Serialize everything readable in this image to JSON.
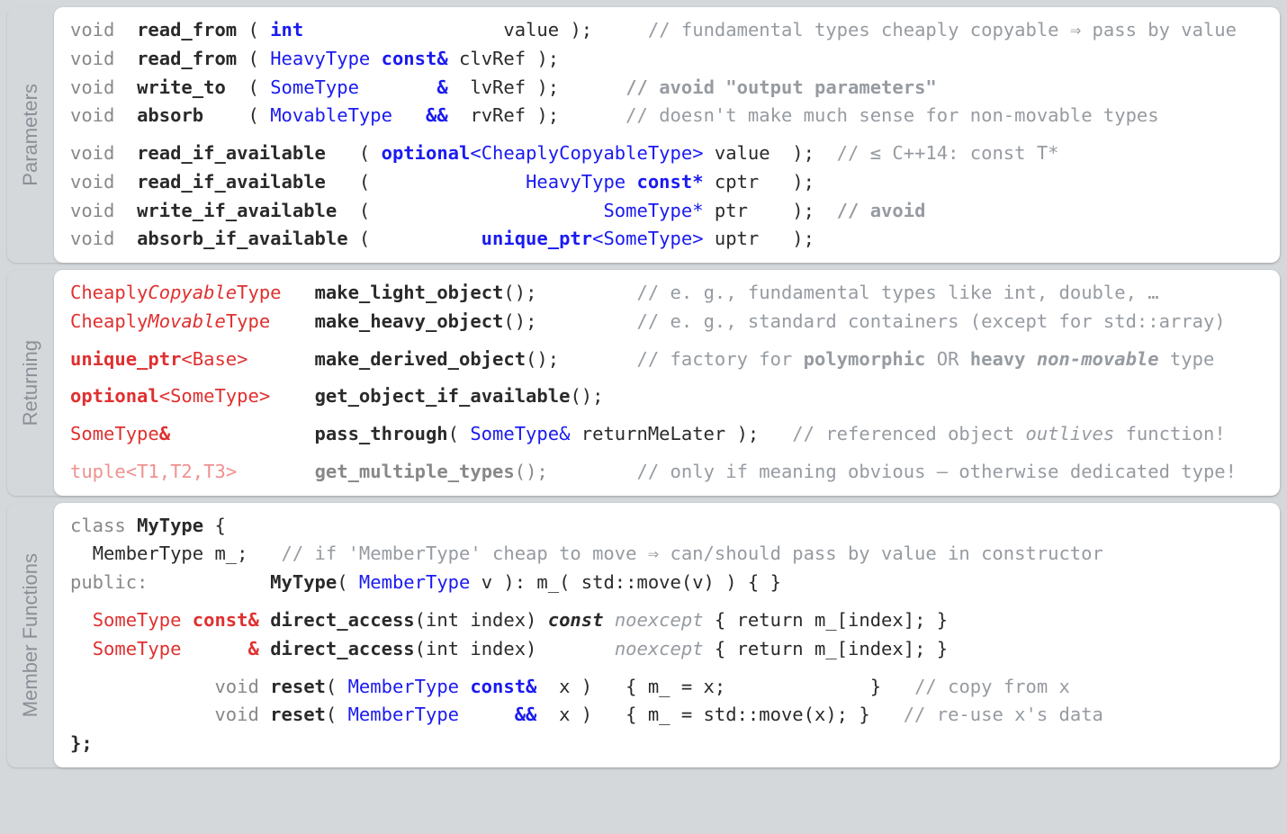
{
  "sections": {
    "parameters": {
      "label": "Parameters",
      "lines": {
        "l1": {
          "void": "void",
          "fn": "read_from",
          "paren": "(",
          "type": "int",
          "arg": "value",
          "end": ");",
          "cm": "// fundamental types cheaply copyable ⇒ pass by value"
        },
        "l2": {
          "void": "void",
          "fn": "read_from",
          "paren": "(",
          "type": "HeavyType",
          "mod": "const&",
          "arg": "clvRef",
          "end": ");"
        },
        "l3": {
          "void": "void",
          "fn": "write_to",
          "paren": "(",
          "type": "SomeType",
          "mod": "&",
          "arg": "lvRef",
          "end": ");",
          "cm": "// avoid \"output parameters\""
        },
        "l4": {
          "void": "void",
          "fn": "absorb",
          "paren": "(",
          "type": "MovableType",
          "mod": "&&",
          "arg": "rvRef",
          "end": ");",
          "cm": "// doesn't make much sense for non-movable types"
        },
        "l5": {
          "void": "void",
          "fn": "read_if_available",
          "paren": "(",
          "type1": "optional",
          "lt": "<",
          "type2": "CheaplyCopyableType",
          "gt": ">",
          "arg": "value",
          "end": ");",
          "cm": "// ≤ C++14: const T*"
        },
        "l6": {
          "void": "void",
          "fn": "read_if_available",
          "paren": "(",
          "type": "HeavyType",
          "mod": "const*",
          "arg": "cptr",
          "end": ");"
        },
        "l7": {
          "void": "void",
          "fn": "write_if_available",
          "paren": "(",
          "type": "SomeType*",
          "arg": "ptr",
          "end": ");",
          "cm": "// avoid"
        },
        "l8": {
          "void": "void",
          "fn": "absorb_if_available",
          "paren": "(",
          "type1": "unique_ptr",
          "lt": "<",
          "type2": "SomeType",
          "gt": ">",
          "arg": "uptr",
          "end": ");"
        }
      }
    },
    "returning": {
      "label": "Returning",
      "lines": {
        "l1": {
          "ret_pre": "Cheaply",
          "ret_em": "Copyable",
          "ret_post": "Type",
          "fn": "make_light_object",
          "paren": "();",
          "cm": "// e. g., fundamental types like int, double, …"
        },
        "l2": {
          "ret_pre": "Cheaply",
          "ret_em": "Movable",
          "ret_post": "Type",
          "fn": "make_heavy_object",
          "paren": "();",
          "cm": "// e. g., standard containers (except for std::array)"
        },
        "l3": {
          "ret": "unique_ptr",
          "lt": "<",
          "inner": "Base",
          "gt": ">",
          "fn": "make_derived_object",
          "paren": "();",
          "cm_pre": "// factory for ",
          "cm_b1": "polymorphic",
          "cm_mid": " OR ",
          "cm_b2": "heavy ",
          "cm_bi": "non-movable",
          "cm_post": " type"
        },
        "l4": {
          "ret": "optional",
          "lt": "<",
          "inner": "SomeType",
          "gt": ">",
          "fn": "get_object_if_available",
          "paren": "();"
        },
        "l5": {
          "ret": "SomeType",
          "amp": "&",
          "fn": "pass_through",
          "open": "(",
          "type": "SomeType&",
          "arg": "returnMeLater",
          "close": ");",
          "cm_pre": "// referenced object ",
          "cm_i": "outlives",
          "cm_post": " function!"
        },
        "l6": {
          "ret": "tuple",
          "lt": "<",
          "inner": "T1,T2,T3",
          "gt": ">",
          "fn": "get_multiple_types",
          "paren": "();",
          "cm": "// only if meaning obvious – otherwise dedicated type!"
        }
      }
    },
    "member": {
      "label": "Member Functions",
      "lines": {
        "l1": {
          "kw": "class",
          "name": "MyType",
          "brace": "{"
        },
        "l2": {
          "indent": "  ",
          "type": "MemberType",
          "arg": "m_;",
          "cm": "// if 'MemberType' cheap to move ⇒ can/should pass by value in constructor"
        },
        "l3": {
          "kw": "public:",
          "ctor": "MyType",
          "open": "(",
          "type": "MemberType",
          "arg": "v",
          "close": ")",
          "init": ": m_( std::move(v) ) { }"
        },
        "l4": {
          "ret": "SomeType",
          "mod": "const&",
          "fn": "direct_access",
          "sig": "(int index)",
          "cv": "const",
          "ne": "noexcept",
          "body": "{ return m_[index]; }"
        },
        "l5": {
          "ret": "SomeType",
          "mod": "&",
          "fn": "direct_access",
          "sig": "(int index)",
          "ne": "noexcept",
          "body": "{ return m_[index]; }"
        },
        "l6": {
          "void": "void",
          "fn": "reset",
          "open": "(",
          "type": "MemberType",
          "mod": "const&",
          "arg": "x",
          "close": ")",
          "body": "{ m_ = x;",
          "brace": "}",
          "cm": "// copy from x"
        },
        "l7": {
          "void": "void",
          "fn": "reset",
          "open": "(",
          "type": "MemberType",
          "mod": "&&",
          "arg": "x",
          "close": ")",
          "body": "{ m_ = std::move(x); }",
          "cm": "// re-use x's data"
        },
        "l8": {
          "brace": "};"
        }
      }
    }
  }
}
